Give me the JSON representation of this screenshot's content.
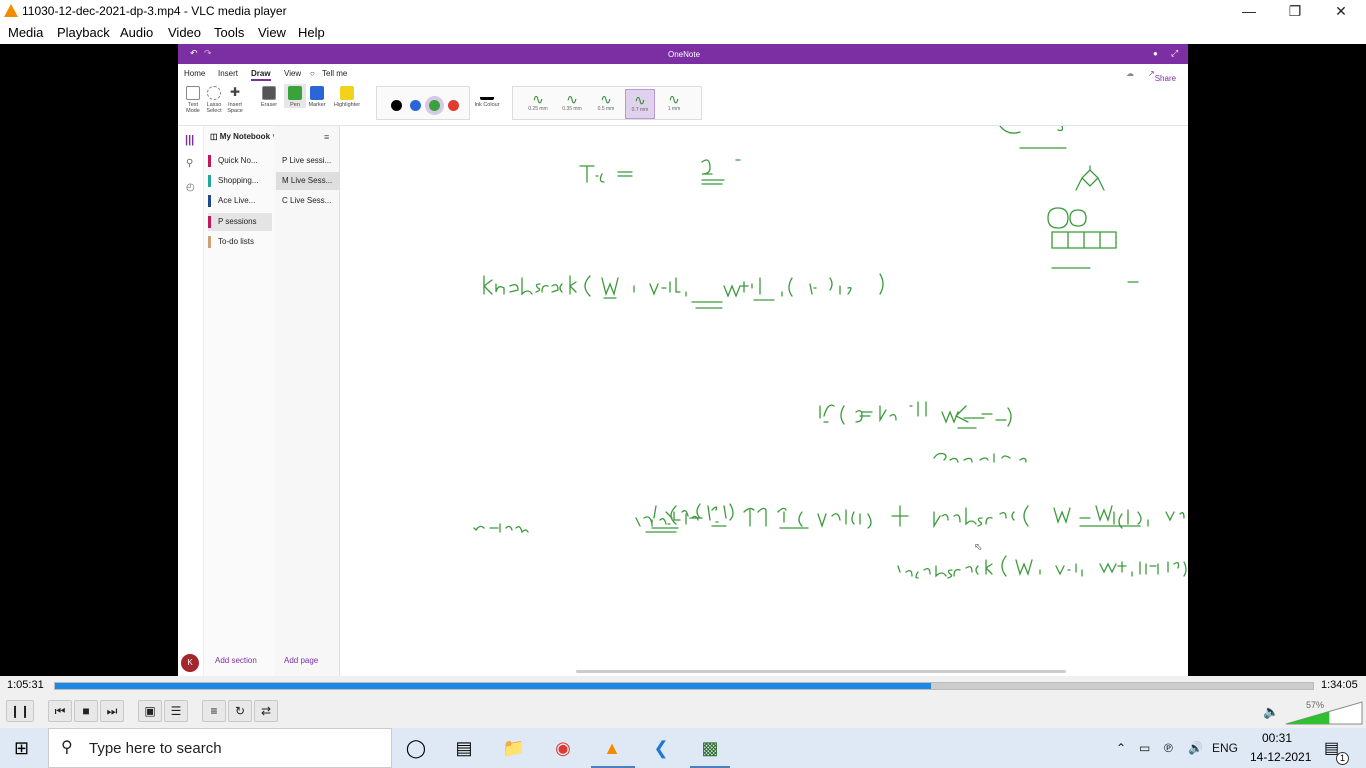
{
  "vlc": {
    "window_title": "11030-12-dec-2021-dp-3.mp4 - VLC media player",
    "menu": [
      "Media",
      "Playback",
      "Audio",
      "Video",
      "Tools",
      "View",
      "Help"
    ],
    "elapsed": "1:05:31",
    "total": "1:34:05",
    "progress": 0.696,
    "volume_label": "57%",
    "volume": 0.57
  },
  "onenote": {
    "app_title": "OneNote",
    "share": "Share",
    "tabs": [
      "Home",
      "Insert",
      "Draw",
      "View",
      "Tell me"
    ],
    "active_tab": "Draw",
    "ribbon_tools": [
      "Text Mode",
      "Lasso Select",
      "Insert Space",
      "Eraser",
      "Pen",
      "Marker",
      "Highlighter"
    ],
    "ink_colour_label": "Ink Colour",
    "colors": [
      "#000000",
      "#2b66d9",
      "#3aa23a",
      "#e03b2e"
    ],
    "thickness": [
      "0.25 mm",
      "0.35 mm",
      "0.5 mm",
      "0.7 mm",
      "1 mm"
    ],
    "notebook": "My Notebook",
    "sections": [
      {
        "label": "Quick No...",
        "color": "#c2185b"
      },
      {
        "label": "Shopping...",
        "color": "#26a69a"
      },
      {
        "label": "Ace Live...",
        "color": "#1e4a8a"
      },
      {
        "label": "P sessions",
        "color": "#c2185b"
      },
      {
        "label": "To-do lists",
        "color": "#c9a27a"
      }
    ],
    "pages": [
      "P Live sessi...",
      "M Live Sess...",
      "C Live Sess..."
    ],
    "add_section": "Add section",
    "add_page": "Add page",
    "avatar_initial": "K"
  },
  "taskbar": {
    "search_placeholder": "Type here to search",
    "lang": "ENG",
    "time": "00:31",
    "date": "14-12-2021",
    "notif_count": "1"
  }
}
